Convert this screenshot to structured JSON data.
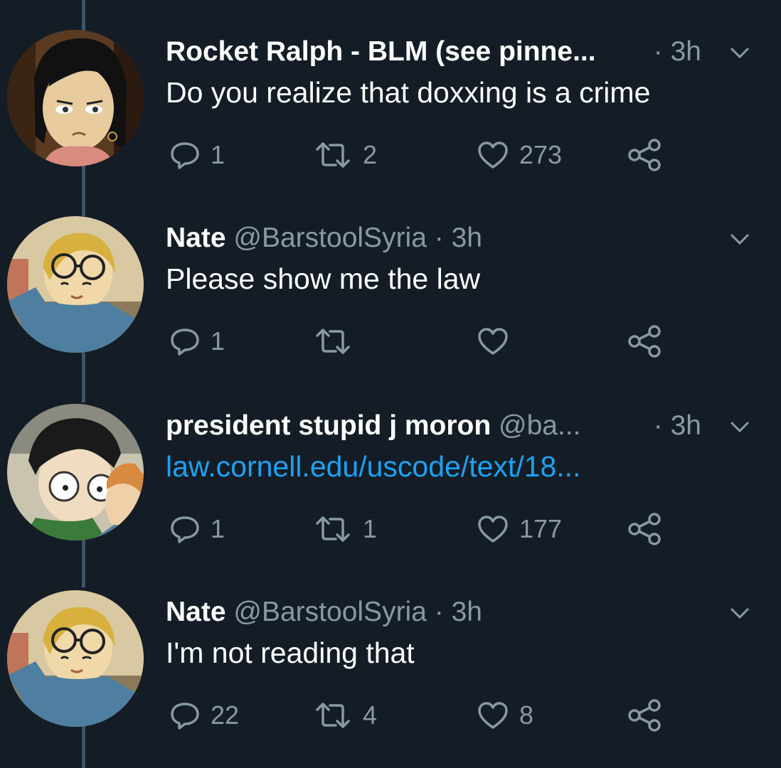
{
  "colors": {
    "background": "#141d26",
    "thread_line": "#3d5466",
    "secondary_text": "#8899a6",
    "link": "#1da1f2"
  },
  "tweets": [
    {
      "name": "Rocket Ralph - BLM (see pinne...",
      "handle": "",
      "time": "· 3h",
      "text": "Do you realize that doxxing is a crime",
      "text_is_link": false,
      "replies": "1",
      "retweets": "2",
      "likes": "273",
      "avatar": "cartoon-girl-avatar"
    },
    {
      "name": "Nate",
      "handle": "@BarstoolSyria · 3h",
      "time": "",
      "text": "Please show me the law",
      "text_is_link": false,
      "replies": "1",
      "retweets": "",
      "likes": "",
      "avatar": "cartoon-boy-glasses-avatar"
    },
    {
      "name": "president stupid j moron",
      "handle": "@ba...",
      "time": "· 3h",
      "text": "law.cornell.edu/uscode/text/18...",
      "text_is_link": true,
      "replies": "1",
      "retweets": "1",
      "likes": "177",
      "avatar": "cartoon-two-boys-avatar"
    },
    {
      "name": "Nate",
      "handle": "@BarstoolSyria · 3h",
      "time": "",
      "text": "I'm not reading that",
      "text_is_link": false,
      "replies": "22",
      "retweets": "4",
      "likes": "8",
      "avatar": "cartoon-boy-glasses-avatar"
    }
  ],
  "icons": {
    "reply": "reply-icon",
    "retweet": "retweet-icon",
    "like": "heart-icon",
    "share": "share-icon",
    "menu": "chevron-down-icon"
  }
}
